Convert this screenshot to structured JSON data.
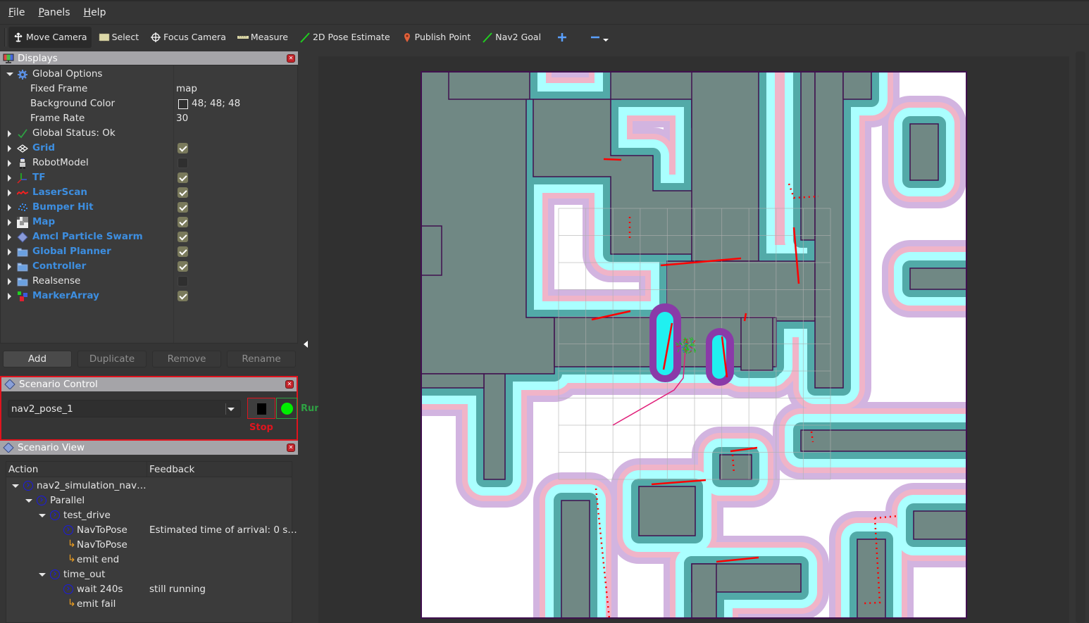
{
  "menu": [
    {
      "label": "File",
      "accel": "F",
      "rest": "ile"
    },
    {
      "label": "Panels",
      "accel": "P",
      "rest": "anels"
    },
    {
      "label": "Help",
      "accel": "H",
      "rest": "elp"
    }
  ],
  "toolbar": {
    "tools": [
      {
        "label": "Move Camera",
        "icon": "move-camera-icon",
        "active": true
      },
      {
        "label": "Select",
        "icon": "select-icon"
      },
      {
        "label": "Focus Camera",
        "icon": "focus-camera-icon"
      },
      {
        "label": "Measure",
        "icon": "measure-icon"
      },
      {
        "label": "2D Pose Estimate",
        "icon": "pose-estimate-icon"
      },
      {
        "label": "Publish Point",
        "icon": "publish-point-icon"
      },
      {
        "label": "Nav2 Goal",
        "icon": "nav2-goal-icon"
      }
    ],
    "add_icon": "plus-icon",
    "remove_icon": "minus-icon"
  },
  "displays": {
    "title": "Displays",
    "global_options": "Global Options",
    "fixed_frame_label": "Fixed Frame",
    "fixed_frame_value": "map",
    "bg_color_label": "Background Color",
    "bg_color_value": "48; 48; 48",
    "frame_rate_label": "Frame Rate",
    "frame_rate_value": "30",
    "global_status": "Global Status: Ok",
    "items": [
      {
        "label": "Grid",
        "checked": true,
        "highlight": true
      },
      {
        "label": "RobotModel",
        "checked": false,
        "highlight": false
      },
      {
        "label": "TF",
        "checked": true,
        "highlight": true
      },
      {
        "label": "LaserScan",
        "checked": true,
        "highlight": true
      },
      {
        "label": "Bumper Hit",
        "checked": true,
        "highlight": true
      },
      {
        "label": "Map",
        "checked": true,
        "highlight": true
      },
      {
        "label": "Amcl Particle Swarm",
        "checked": true,
        "highlight": true
      },
      {
        "label": "Global Planner",
        "checked": true,
        "highlight": true
      },
      {
        "label": "Controller",
        "checked": true,
        "highlight": true
      },
      {
        "label": "Realsense",
        "checked": false,
        "highlight": false
      },
      {
        "label": "MarkerArray",
        "checked": true,
        "highlight": true
      }
    ],
    "buttons": {
      "add": "Add",
      "duplicate": "Duplicate",
      "remove": "Remove",
      "rename": "Rename"
    }
  },
  "scenario_control": {
    "title": "Scenario Control",
    "selected_scenario": "nav2_pose_1",
    "stop_label": "Stop",
    "status_label": "Running",
    "colors": {
      "stop": "#e0141e",
      "running": "#2ea043",
      "running_dot": "#00ee00"
    }
  },
  "scenario_view": {
    "title": "Scenario View",
    "columns": [
      "Action",
      "Feedback"
    ],
    "rows": [
      {
        "depth": 0,
        "kind": "node",
        "expanded": true,
        "action": "nav2_simulation_nav…",
        "feedback": ""
      },
      {
        "depth": 1,
        "kind": "node",
        "expanded": true,
        "action": "Parallel",
        "feedback": ""
      },
      {
        "depth": 2,
        "kind": "node",
        "expanded": true,
        "action": "test_drive",
        "feedback": ""
      },
      {
        "depth": 3,
        "kind": "leaf",
        "action": "NavToPose",
        "feedback": "Estimated time of arrival: 0 s…"
      },
      {
        "depth": 3,
        "kind": "return",
        "action": "NavToPose",
        "feedback": ""
      },
      {
        "depth": 3,
        "kind": "return",
        "action": "emit end",
        "feedback": ""
      },
      {
        "depth": 2,
        "kind": "node",
        "expanded": true,
        "action": "time_out",
        "feedback": ""
      },
      {
        "depth": 3,
        "kind": "leaf",
        "action": "wait 240s",
        "feedback": "still running"
      },
      {
        "depth": 3,
        "kind": "return",
        "action": "emit fail",
        "feedback": ""
      }
    ]
  },
  "viewport": {
    "background_color": "#303030",
    "map_colors": {
      "free": "#ffffff",
      "obstacle": "#708884",
      "inflation_teal": "#52aaa8",
      "inflation_cyan": "#aaffff",
      "inflation_pink": "#f0b4c8",
      "inflation_lilac": "#d2b4e0",
      "wall_edge": "#40104e",
      "laser": "#ff0000",
      "plan": "#e0207a"
    }
  }
}
